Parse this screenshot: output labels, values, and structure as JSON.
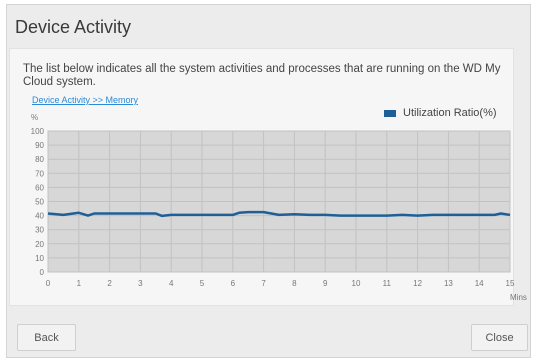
{
  "dialog": {
    "title": "Device Activity",
    "description": "The list below indicates all the system activities and processes that are running on the WD My Cloud system.",
    "breadcrumb": "Device Activity >> Memory",
    "back_label": "Back",
    "close_label": "Close"
  },
  "chart_data": {
    "type": "line",
    "y_unit_label": "%",
    "xlabel": "Mins",
    "ylim": [
      0,
      100
    ],
    "xlim": [
      0,
      15
    ],
    "y_ticks": [
      0,
      10,
      20,
      30,
      40,
      50,
      60,
      70,
      80,
      90,
      100
    ],
    "x_ticks": [
      0,
      1,
      2,
      3,
      4,
      5,
      6,
      7,
      8,
      9,
      10,
      11,
      12,
      13,
      14,
      15
    ],
    "grid": true,
    "legend_position": "top-right",
    "series": [
      {
        "name": "Utilization Ratio(%)",
        "color": "#1f5f97",
        "x": [
          0,
          0.5,
          1,
          1.3,
          1.5,
          2,
          2.5,
          3,
          3.5,
          3.7,
          4,
          4.5,
          5,
          5.5,
          6,
          6.2,
          6.5,
          7,
          7.5,
          8,
          8.5,
          9,
          9.5,
          10,
          10.5,
          11,
          11.5,
          12,
          12.5,
          13,
          13.5,
          14,
          14.5,
          14.7,
          15
        ],
        "y": [
          41.5,
          40.5,
          42,
          40,
          41.5,
          41.5,
          41.5,
          41.5,
          41.5,
          39.8,
          40.5,
          40.5,
          40.5,
          40.5,
          40.5,
          42,
          42.5,
          42.5,
          40.5,
          41,
          40.5,
          40.5,
          40,
          40,
          40,
          40,
          40.5,
          40,
          40.5,
          40.5,
          40.5,
          40.5,
          40.5,
          41.5,
          40.5
        ]
      }
    ]
  }
}
